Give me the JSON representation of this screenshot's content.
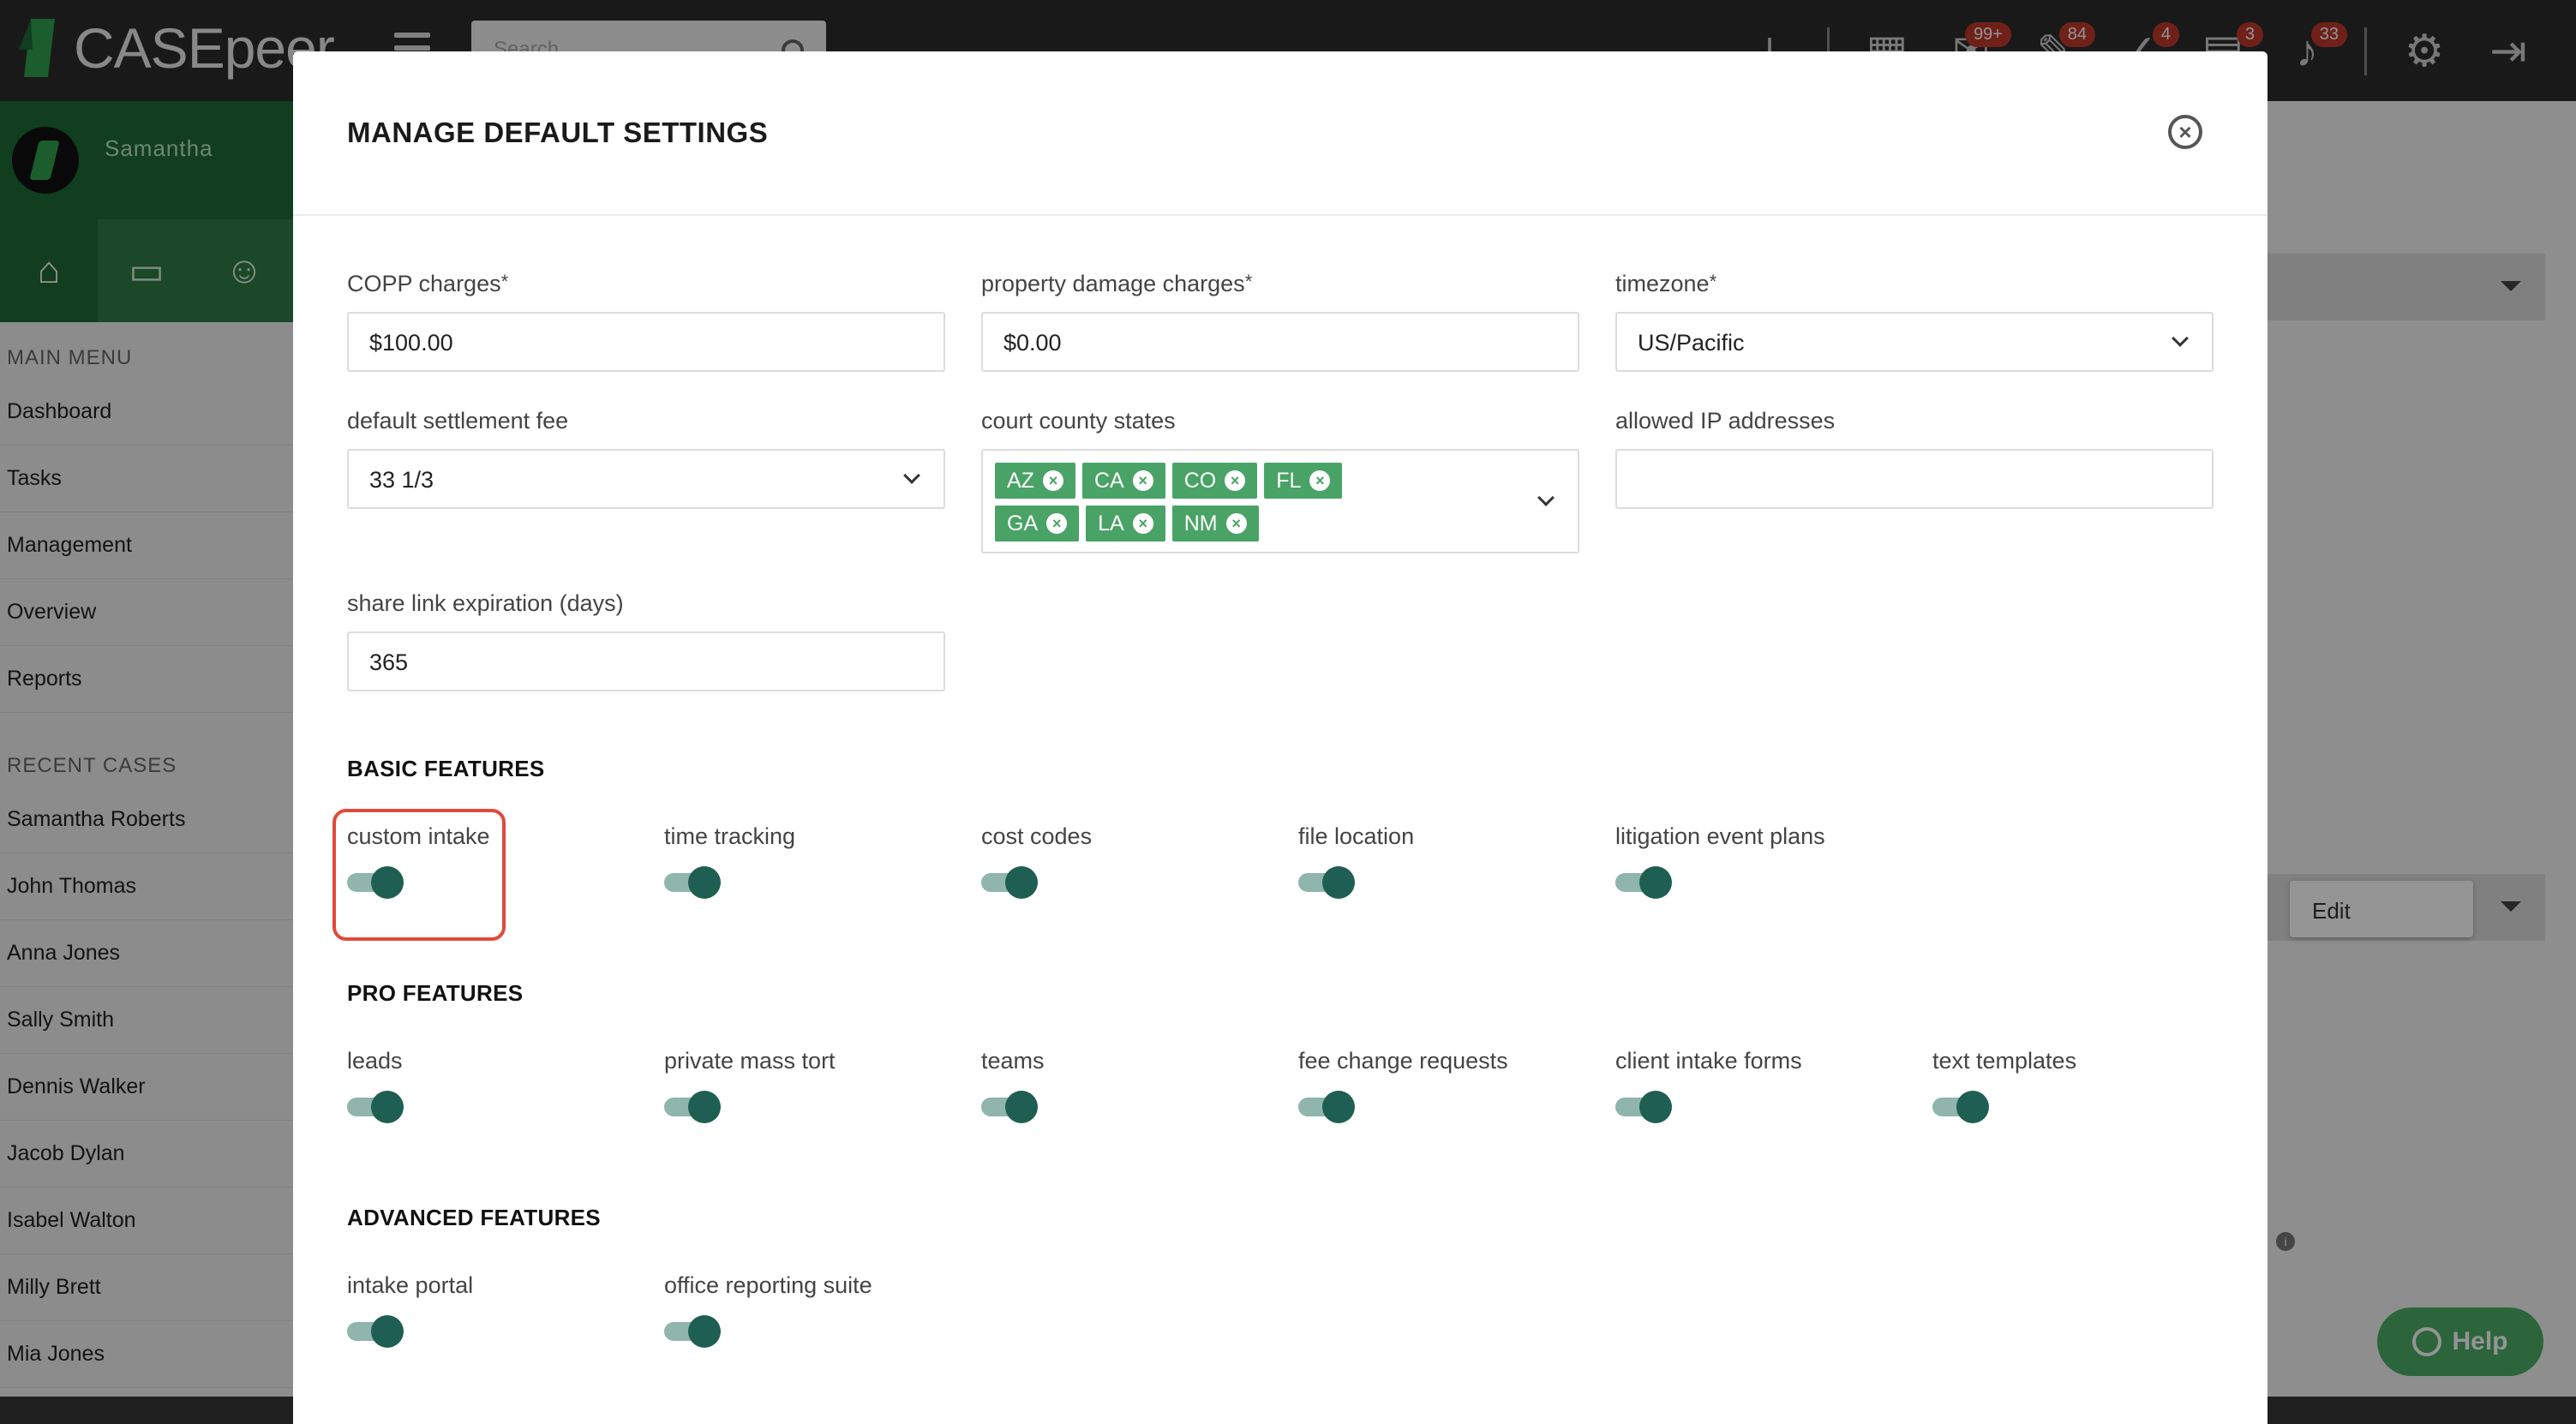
{
  "app": {
    "logo_text": "CASEpeer",
    "search_placeholder": "Search",
    "badges": {
      "messages": "99+",
      "chat": "84",
      "tasks": "4",
      "docs": "3",
      "notifications": "33"
    }
  },
  "sidebar": {
    "user_name": "Samantha",
    "main_menu_title": "MAIN MENU",
    "main_menu": [
      "Dashboard",
      "Tasks",
      "Management",
      "Overview",
      "Reports"
    ],
    "recent_cases_title": "RECENT CASES",
    "recent_cases": [
      "Samantha Roberts",
      "John Thomas",
      "Anna Jones",
      "Sally Smith",
      "Dennis Walker",
      "Jacob Dylan",
      "Isabel Walton",
      "Milly Brett",
      "Mia Jones"
    ]
  },
  "background": {
    "edit_label": "Edit",
    "help_label": "Help"
  },
  "modal": {
    "title": "MANAGE DEFAULT SETTINGS",
    "fields": {
      "copp_label": "COPP charges",
      "copp_value": "$100.00",
      "property_label": "property damage charges",
      "property_value": "$0.00",
      "timezone_label": "timezone",
      "timezone_value": "US/Pacific",
      "settlement_label": "default settlement fee",
      "settlement_value": "33 1/3",
      "county_label": "court county states",
      "county_states": [
        "AZ",
        "CA",
        "CO",
        "FL",
        "GA",
        "LA",
        "NM"
      ],
      "ip_label": "allowed IP addresses",
      "ip_value": "",
      "share_label": "share link expiration (days)",
      "share_value": "365",
      "required_marker": "*"
    },
    "sections": {
      "basic_title": "BASIC FEATURES",
      "basic": [
        "custom intake",
        "time tracking",
        "cost codes",
        "file location",
        "litigation event plans"
      ],
      "pro_title": "PRO FEATURES",
      "pro": [
        "leads",
        "private mass tort",
        "teams",
        "fee change requests",
        "client intake forms",
        "text templates"
      ],
      "advanced_title": "ADVANCED FEATURES",
      "advanced": [
        "intake portal",
        "office reporting suite"
      ]
    },
    "toggles_on": true,
    "colors": {
      "tag": "#4aa366",
      "toggle_knob": "#1f5e52",
      "toggle_track": "#8fb5ad",
      "highlight": "#e04a3a"
    }
  }
}
